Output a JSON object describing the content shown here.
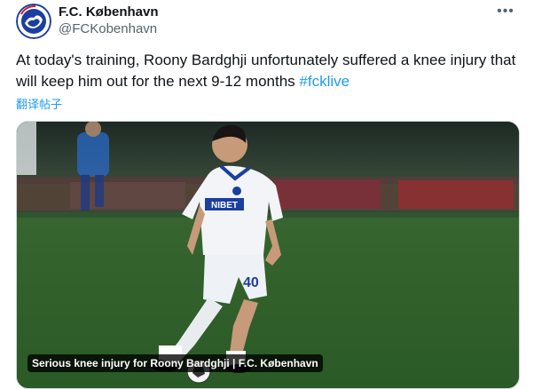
{
  "account": {
    "display_name": "F.C. København",
    "handle": "@FCKobenhavn",
    "avatar_icon": "fc-kobenhavn-crest-icon",
    "more_icon": "more-options-icon"
  },
  "tweet": {
    "text": "At today's training, Roony Bardghji unfortunately suffered a knee injury that will keep him out for the next 9-12 months ",
    "hashtag": "#fcklive",
    "translate_label": "翻译帖子"
  },
  "media": {
    "caption": "Serious knee injury for Roony Bardghji | F.C. København",
    "jersey_sponsor": "NIBET",
    "jersey_number": "40"
  },
  "colors": {
    "link": "#1d9bf0",
    "secondary_text": "#536471",
    "crest_blue": "#1b3fa0"
  }
}
